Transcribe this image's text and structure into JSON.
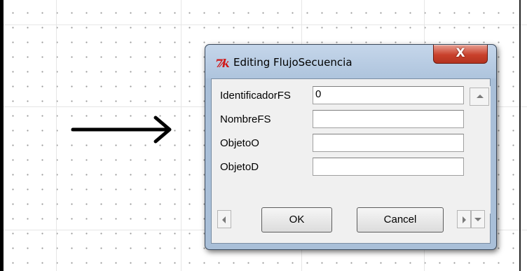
{
  "dialog": {
    "title": "Editing FlujoSecuencia",
    "close_label": "X",
    "fields": [
      {
        "label": "IdentificadorFS",
        "value": "0"
      },
      {
        "label": "NombreFS",
        "value": ""
      },
      {
        "label": "ObjetoO",
        "value": ""
      },
      {
        "label": "ObjetoD",
        "value": ""
      }
    ],
    "ok_label": "OK",
    "cancel_label": "Cancel"
  },
  "icons": {
    "app": "tk-feather-icon",
    "canvas_arrow": "right-arrow-icon"
  },
  "colors": {
    "close_button": "#c9412c",
    "window_frame": "#a9bfd8",
    "client_bg": "#f0f0f0"
  }
}
